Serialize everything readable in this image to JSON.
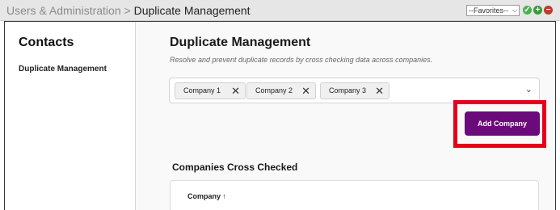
{
  "topbar": {
    "breadcrumb_parent": "Users & Administration",
    "breadcrumb_sep": ">",
    "breadcrumb_current": "Duplicate Management",
    "favorites_value": "--Favorites--",
    "icons": [
      "check-circle-icon",
      "plus-circle-icon",
      "minus-circle-icon"
    ],
    "colors": {
      "check": "#4caf50",
      "plus": "#3c9a3c",
      "minus": "#c0392b"
    }
  },
  "sidebar": {
    "title": "Contacts",
    "items": [
      {
        "label": "Duplicate Management"
      }
    ]
  },
  "main": {
    "title": "Duplicate Management",
    "subtitle": "Resolve and prevent duplicate records by cross checking data across companies.",
    "selected_companies": [
      {
        "label": "Company 1"
      },
      {
        "label": "Company 2"
      },
      {
        "label": "Company 3"
      }
    ],
    "add_button_label": "Add Company",
    "section_title": "Companies Cross Checked",
    "table": {
      "columns": [
        {
          "label": "Company",
          "sort": "↑"
        }
      ]
    }
  },
  "colors": {
    "accent": "#6b0a7a",
    "highlight": "#e5001b"
  }
}
